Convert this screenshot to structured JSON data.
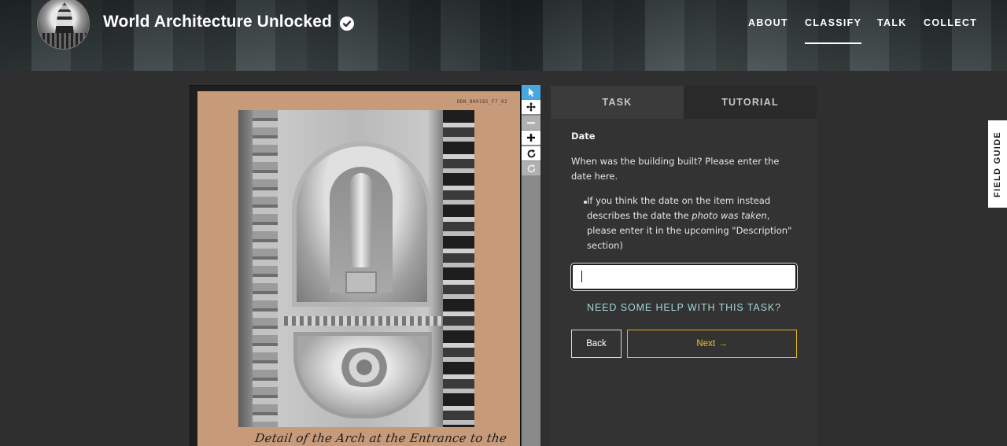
{
  "header": {
    "project_title": "World Architecture Unlocked",
    "avatar_icon": "pagoda-avatar-icon",
    "verified_icon": "check-badge-icon",
    "nav": [
      {
        "label": "ABOUT",
        "active": false
      },
      {
        "label": "CLASSIFY",
        "active": true
      },
      {
        "label": "TALK",
        "active": false
      },
      {
        "label": "COLLECT",
        "active": false
      }
    ]
  },
  "subject": {
    "card_id": "ODN_800185_F7_02",
    "caption": "Detail of the Arch at the Entrance to the Loggia."
  },
  "toolbar": {
    "tools": [
      "cursor-icon",
      "move-icon",
      "minus-icon",
      "plus-icon",
      "rotate-icon",
      "reset-icon"
    ]
  },
  "task_panel": {
    "tabs": [
      {
        "label": "TASK",
        "active": true
      },
      {
        "label": "TUTORIAL",
        "active": false
      }
    ],
    "question_title": "Date",
    "question_text": "When was the building built? Please enter the date here.",
    "bullet_prefix": "If you think the date on the item instead describes the date the ",
    "bullet_emphasis": "photo was taken",
    "bullet_suffix": ", please enter it in the upcoming \"Description\" section)",
    "date_input_value": "",
    "help_link": "NEED SOME HELP WITH THIS TASK?",
    "back_label": "Back",
    "next_label": "Next",
    "next_arrow": "→"
  },
  "field_guide_label": "FIELD GUIDE",
  "colors": {
    "accent": "#e4b31b",
    "link": "#a7d6d6",
    "tool_active": "#47a8e0"
  }
}
